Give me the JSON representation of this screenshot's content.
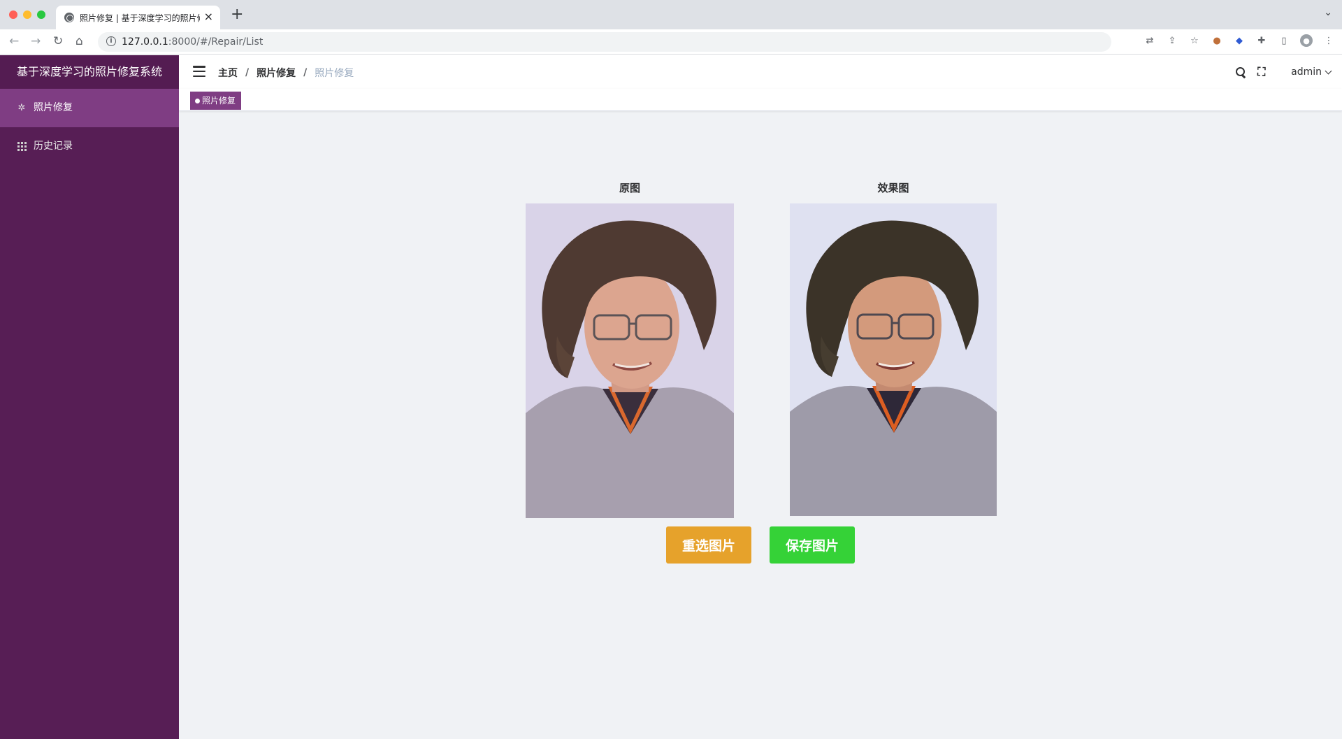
{
  "browser": {
    "tab_title": "照片修复 | 基于深度学习的照片修复系统",
    "url_host": "127.0.0.1",
    "url_rest": ":8000/#/Repair/List",
    "toolbar_icons": [
      "translate-icon",
      "share-icon",
      "star-icon",
      "extension-face-icon",
      "extension-shield-icon",
      "puzzle-icon",
      "sidepanel-icon",
      "profile-icon",
      "more-icon"
    ]
  },
  "sidebar": {
    "title": "基于深度学习的照片修复系统",
    "items": [
      {
        "label": "照片修复",
        "icon": "magic-icon",
        "active": true
      },
      {
        "label": "历史记录",
        "icon": "grid-icon",
        "active": false
      }
    ]
  },
  "navbar": {
    "breadcrumb": [
      "主页",
      "照片修复",
      "照片修复"
    ],
    "user": "admin"
  },
  "tags": {
    "active_tag": "照片修复"
  },
  "content": {
    "original_label": "原图",
    "result_label": "效果图",
    "reselect_button": "重选图片",
    "save_button": "保存图片"
  },
  "colors": {
    "sidebar_bg": "#571e55",
    "accent": "#7f3d83",
    "reselect": "#e6a22b",
    "save": "#35d237"
  }
}
